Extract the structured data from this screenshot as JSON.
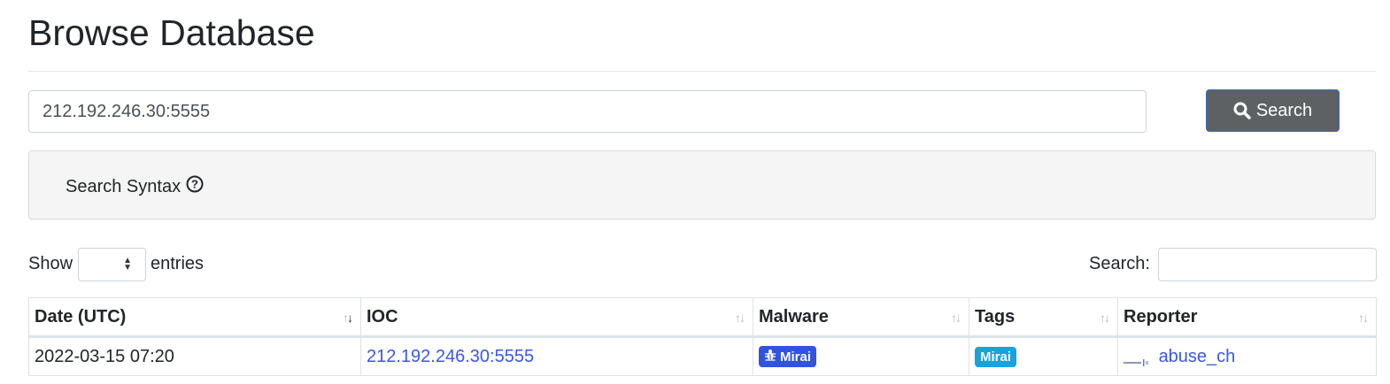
{
  "page": {
    "title": "Browse Database"
  },
  "search": {
    "value": "212.192.246.30:5555",
    "button_label": "Search"
  },
  "syntax": {
    "label": "Search Syntax"
  },
  "length_menu": {
    "show_label": "Show",
    "entries_label": "entries"
  },
  "filter": {
    "label": "Search:"
  },
  "table": {
    "columns": [
      "Date (UTC)",
      "IOC",
      "Malware",
      "Tags",
      "Reporter"
    ],
    "rows": [
      {
        "date": "2022-03-15 07:20",
        "ioc": "212.192.246.30:5555",
        "malware": "Mirai",
        "tag": "Mirai",
        "reporter": "abuse_ch"
      }
    ]
  },
  "colors": {
    "link": "#3a57e8",
    "malware_badge": "#3053e0",
    "tag_badge": "#17a2e0",
    "search_button": "#5e6164"
  }
}
